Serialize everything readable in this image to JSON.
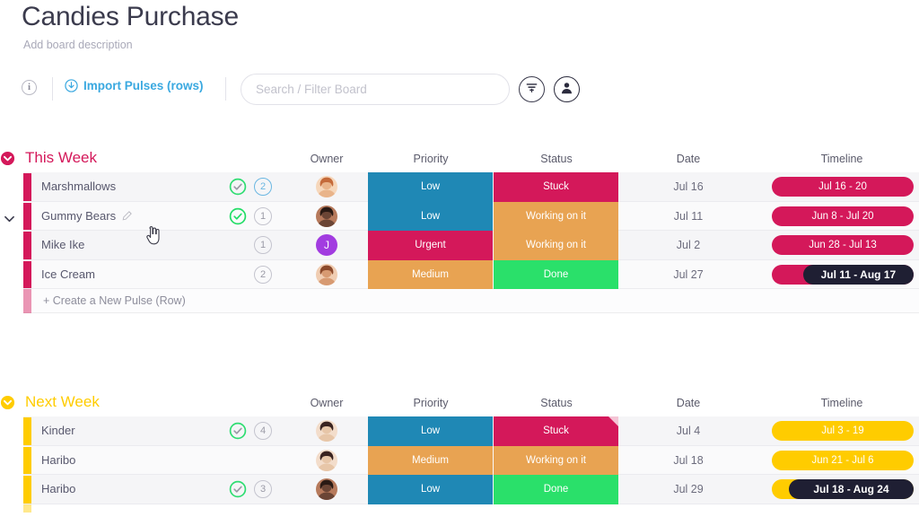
{
  "board": {
    "title": "Candies Purchase",
    "description": "Add board description"
  },
  "toolbar": {
    "info_icon": "info-icon",
    "import_label": "Import Pulses (rows)",
    "import_icon": "download-circle-icon",
    "search_placeholder": "Search / Filter Board",
    "search_value": "",
    "filter_icon": "filter-icon",
    "person_icon": "person-icon"
  },
  "columns": [
    "Owner",
    "Priority",
    "Status",
    "Date",
    "Timeline"
  ],
  "colors": {
    "crimson": "#d4185a",
    "blue": "#1f88b5",
    "orange": "#e8a352",
    "green": "#2ae06a",
    "yellow": "#ffcc00",
    "dark": "#1f1f33",
    "purple": "#a23ce0"
  },
  "groups": [
    {
      "title": "This Week",
      "color": "#d4185a",
      "toggle_icon": "chevron-down-circle-icon",
      "add_row_label": "+ Create a New Pulse (Row)",
      "rows": [
        {
          "name": "Marshmallows",
          "editable": false,
          "check": true,
          "check_style": "light",
          "count": "2",
          "count_style": "blue",
          "avatar": "photo-woman-1",
          "avatar_letter": "",
          "priority": "Low",
          "priority_color": "#1f88b5",
          "status": "Stuck",
          "status_color": "#d4185a",
          "status_fold": false,
          "date": "Jul 16",
          "timeline": "Jul 16 - 20",
          "timeline_color": "#d4185a",
          "timeline_overlay": "",
          "timeline_overlay_pct": 0
        },
        {
          "name": "Gummy Bears",
          "editable": true,
          "check": true,
          "check_style": "solid",
          "count": "1",
          "count_style": "grey",
          "avatar": "photo-woman-2",
          "avatar_letter": "",
          "priority": "Low",
          "priority_color": "#1f88b5",
          "status": "Working on it",
          "status_color": "#e8a352",
          "status_fold": false,
          "date": "Jul 11",
          "timeline": "Jun 8 - Jul 20",
          "timeline_color": "#d4185a",
          "timeline_overlay": "",
          "timeline_overlay_pct": 0
        },
        {
          "name": "Mike Ike",
          "editable": false,
          "check": false,
          "check_style": "",
          "count": "1",
          "count_style": "grey",
          "avatar": "",
          "avatar_letter": "J",
          "priority": "Urgent",
          "priority_color": "#d4185a",
          "status": "Working on it",
          "status_color": "#e8a352",
          "status_fold": false,
          "date": "Jul 2",
          "timeline": "Jun 28 - Jul 13",
          "timeline_color": "#d4185a",
          "timeline_overlay": "",
          "timeline_overlay_pct": 0
        },
        {
          "name": "Ice Cream",
          "editable": false,
          "check": false,
          "check_style": "",
          "count": "2",
          "count_style": "grey",
          "avatar": "photo-woman-3",
          "avatar_letter": "",
          "priority": "Medium",
          "priority_color": "#e8a352",
          "status": "Done",
          "status_color": "#2ae06a",
          "status_fold": false,
          "date": "Jul 27",
          "timeline": "Jul 11 - Aug 17",
          "timeline_color": "#d4185a",
          "timeline_overlay": "Jul 11 - Aug 17",
          "timeline_overlay_pct": 78
        }
      ]
    },
    {
      "title": "Next Week",
      "color": "#ffcc00",
      "toggle_icon": "chevron-down-circle-icon",
      "add_row_label": "",
      "rows": [
        {
          "name": "Kinder",
          "editable": false,
          "check": true,
          "check_style": "light",
          "count": "4",
          "count_style": "grey",
          "avatar": "photo-woman-4",
          "avatar_letter": "",
          "priority": "Low",
          "priority_color": "#1f88b5",
          "status": "Stuck",
          "status_color": "#d4185a",
          "status_fold": true,
          "date": "Jul 4",
          "timeline": "Jul 3 - 19",
          "timeline_color": "#ffcc00",
          "timeline_overlay": "",
          "timeline_overlay_pct": 0
        },
        {
          "name": "Haribo",
          "editable": false,
          "check": false,
          "check_style": "",
          "count": "",
          "count_style": "",
          "avatar": "photo-woman-4",
          "avatar_letter": "",
          "priority": "Medium",
          "priority_color": "#e8a352",
          "status": "Working on it",
          "status_color": "#e8a352",
          "status_fold": false,
          "date": "Jul 18",
          "timeline": "Jun 21 - Jul 6",
          "timeline_color": "#ffcc00",
          "timeline_overlay": "",
          "timeline_overlay_pct": 0
        },
        {
          "name": "Haribo",
          "editable": false,
          "check": true,
          "check_style": "light",
          "count": "3",
          "count_style": "grey",
          "avatar": "photo-woman-2",
          "avatar_letter": "",
          "priority": "Low",
          "priority_color": "#1f88b5",
          "status": "Done",
          "status_color": "#2ae06a",
          "status_fold": false,
          "date": "Jul 29",
          "timeline": "Jul 18 - Aug 24",
          "timeline_color": "#ffcc00",
          "timeline_overlay": "Jul 18 - Aug 24",
          "timeline_overlay_pct": 88
        }
      ]
    }
  ]
}
